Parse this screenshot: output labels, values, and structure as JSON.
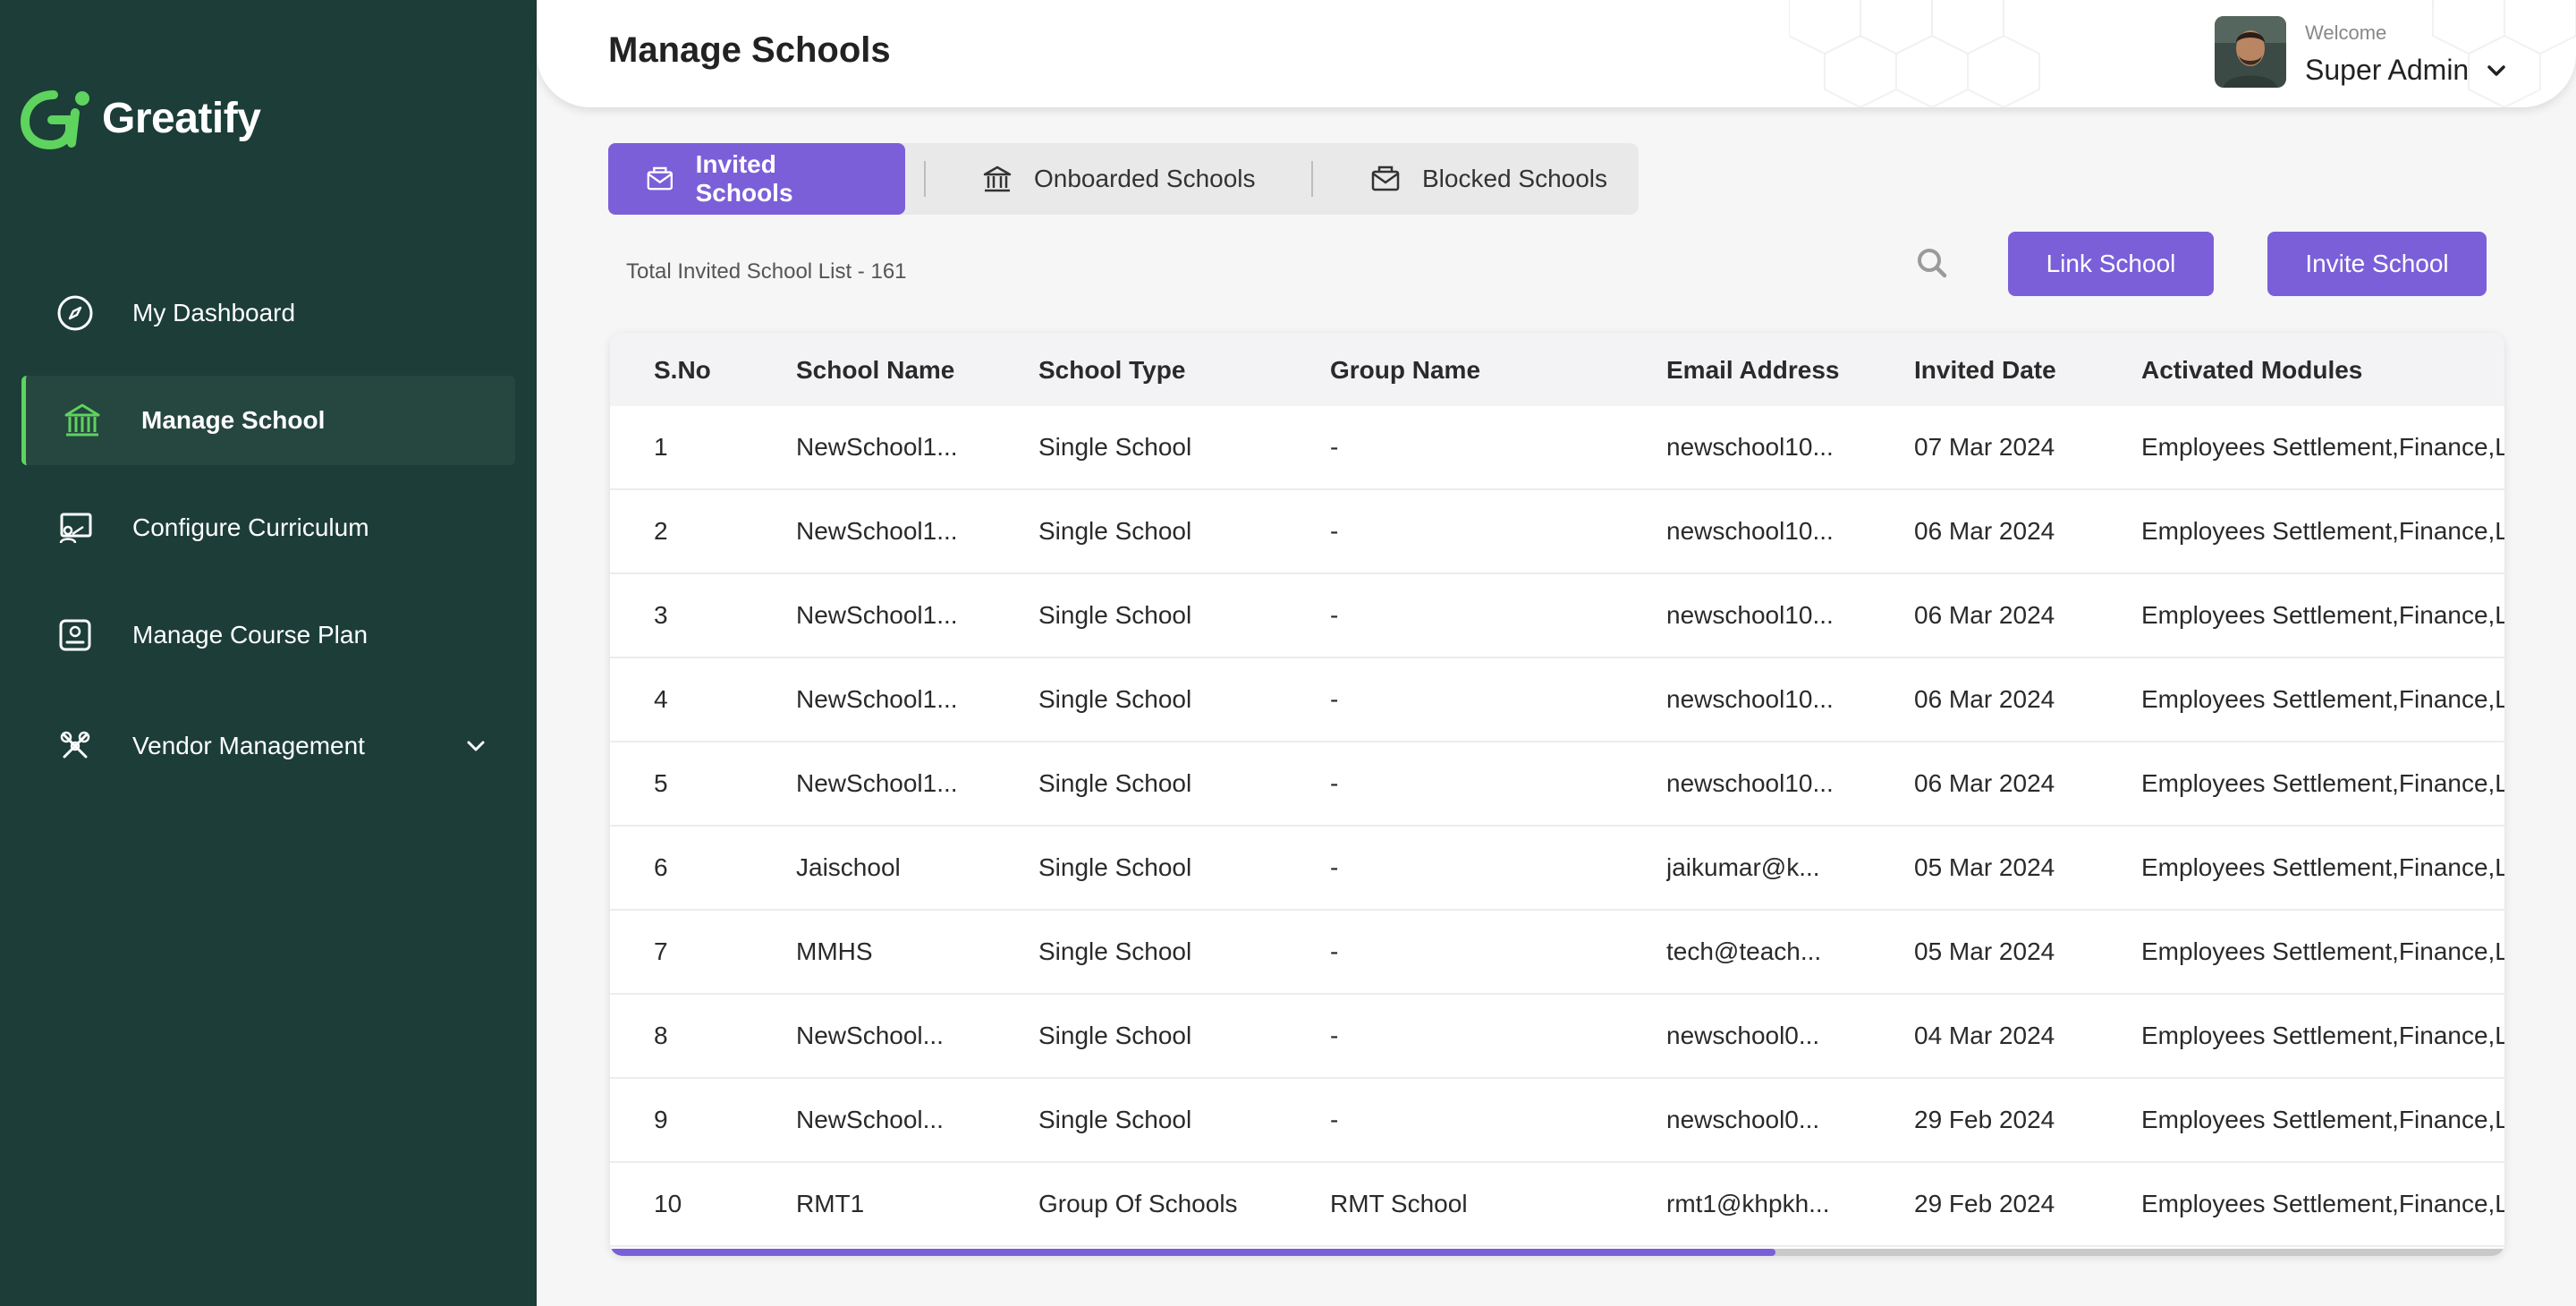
{
  "brand": {
    "name": "Greatify",
    "accent": "#5ed35e",
    "primary": "#7b5fd9",
    "sidebar_bg": "#1c3d38"
  },
  "sidebar": {
    "items": [
      {
        "label": "My Dashboard",
        "icon": "compass-icon",
        "active": false
      },
      {
        "label": "Manage School",
        "icon": "school-building-icon",
        "active": true
      },
      {
        "label": "Configure Curriculum",
        "icon": "teacher-board-icon",
        "active": false
      },
      {
        "label": "Manage Course Plan",
        "icon": "course-plan-icon",
        "active": false
      },
      {
        "label": "Vendor Management",
        "icon": "vendor-icon",
        "active": false,
        "expandable": true
      }
    ]
  },
  "header": {
    "title": "Manage Schools",
    "welcome": "Welcome",
    "user_name": "Super Admin"
  },
  "tabs": [
    {
      "label": "Invited Schools",
      "icon": "invite-envelope-icon",
      "active": true
    },
    {
      "label": "Onboarded Schools",
      "icon": "school-building-icon",
      "active": false
    },
    {
      "label": "Blocked Schools",
      "icon": "blocked-envelope-icon",
      "active": false
    }
  ],
  "toolbar": {
    "total_label": "Total Invited School List - 161",
    "link_label": "Link School",
    "invite_label": "Invite School"
  },
  "table": {
    "columns": [
      "S.No",
      "School Name",
      "School Type",
      "Group Name",
      "Email Address",
      "Invited Date",
      "Activated Modules"
    ],
    "rows": [
      [
        "1",
        "NewSchool1...",
        "Single School",
        "-",
        "newschool10...",
        "07 Mar 2024",
        "Employees Settlement,Finance,L"
      ],
      [
        "2",
        "NewSchool1...",
        "Single School",
        "-",
        "newschool10...",
        "06 Mar 2024",
        "Employees Settlement,Finance,L"
      ],
      [
        "3",
        "NewSchool1...",
        "Single School",
        "-",
        "newschool10...",
        "06 Mar 2024",
        "Employees Settlement,Finance,L"
      ],
      [
        "4",
        "NewSchool1...",
        "Single School",
        "-",
        "newschool10...",
        "06 Mar 2024",
        "Employees Settlement,Finance,L"
      ],
      [
        "5",
        "NewSchool1...",
        "Single School",
        "-",
        "newschool10...",
        "06 Mar 2024",
        "Employees Settlement,Finance,L"
      ],
      [
        "6",
        "Jaischool",
        "Single School",
        "-",
        "jaikumar@k...",
        "05 Mar 2024",
        "Employees Settlement,Finance,L"
      ],
      [
        "7",
        "MMHS",
        "Single School",
        "-",
        "tech@teach...",
        "05 Mar 2024",
        "Employees Settlement,Finance,L"
      ],
      [
        "8",
        "NewSchool...",
        "Single School",
        "-",
        "newschool0...",
        "04 Mar 2024",
        "Employees Settlement,Finance,L"
      ],
      [
        "9",
        "NewSchool...",
        "Single School",
        "-",
        "newschool0...",
        "29 Feb 2024",
        "Employees Settlement,Finance,L"
      ],
      [
        "10",
        "RMT1",
        "Group Of Schools",
        "RMT School",
        "rmt1@khpkh...",
        "29 Feb 2024",
        "Employees Settlement,Finance,L"
      ]
    ]
  },
  "horizontal_scroll": {
    "position_fraction": 0.615
  }
}
